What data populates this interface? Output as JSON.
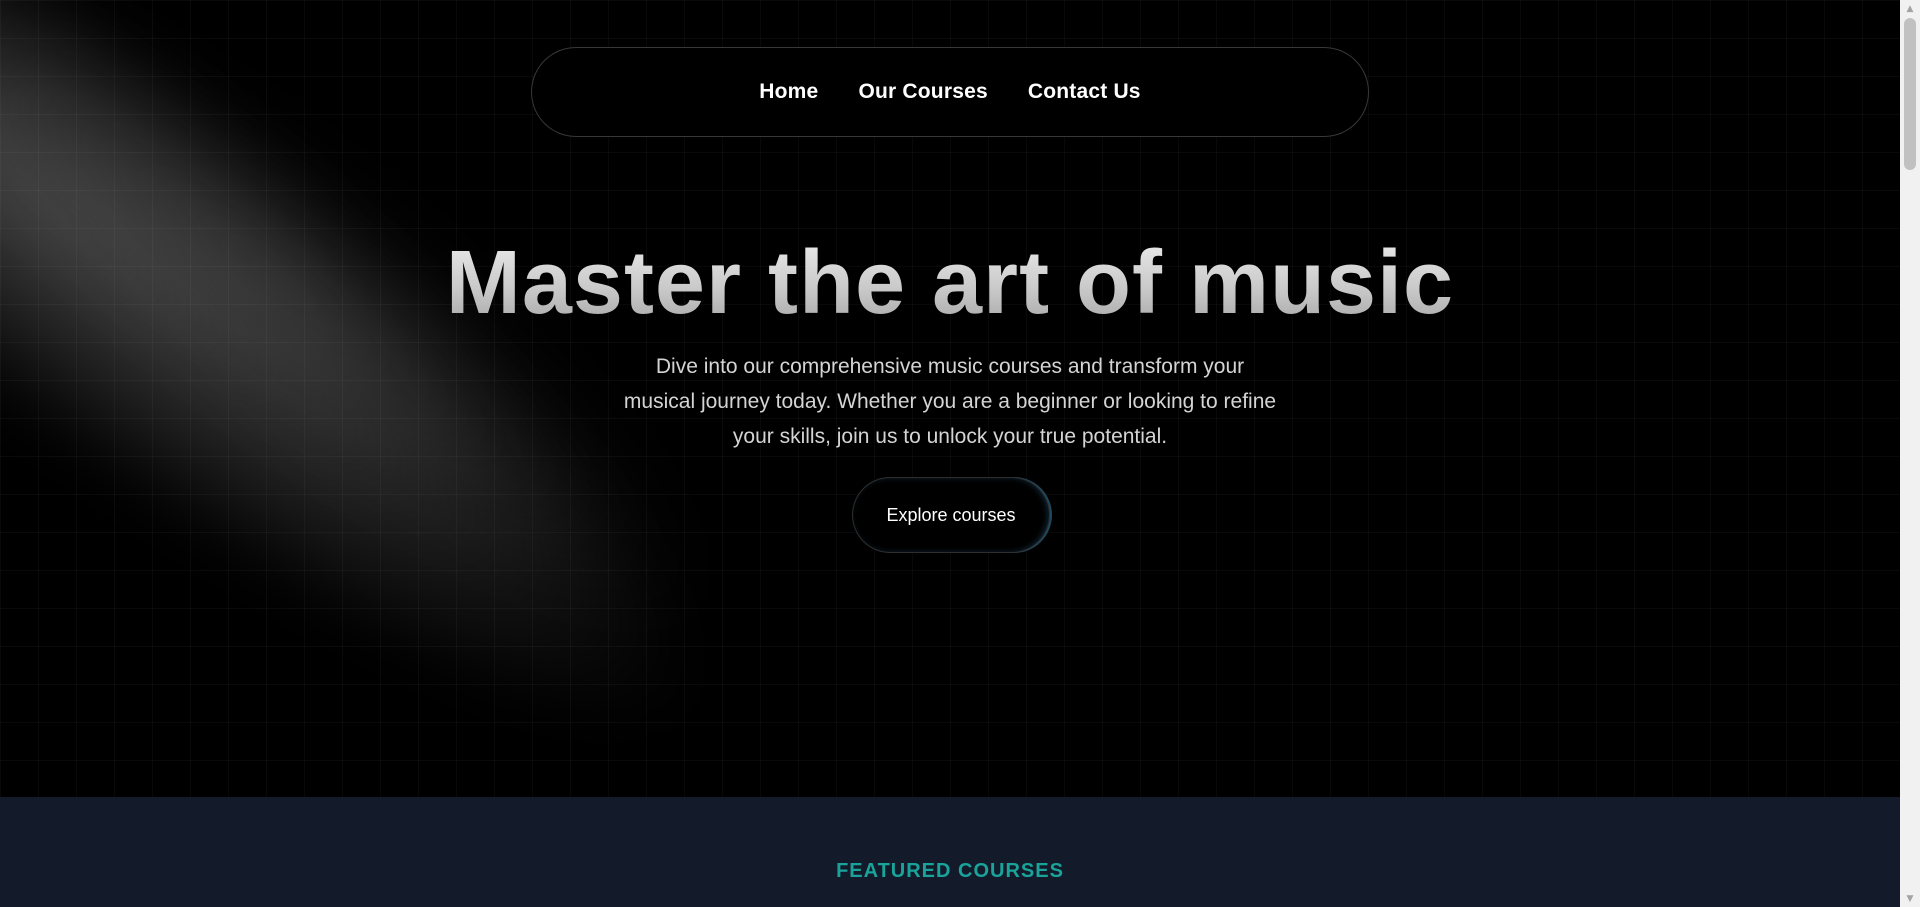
{
  "nav": {
    "items": [
      {
        "label": "Home"
      },
      {
        "label": "Our Courses"
      },
      {
        "label": "Contact Us"
      }
    ]
  },
  "hero": {
    "title": "Master the art of music",
    "subtitle": "Dive into our comprehensive music courses and transform your musical journey today. Whether you are a beginner or looking to refine your skills, join us to unlock your true potential.",
    "cta_label": "Explore courses"
  },
  "featured": {
    "heading": "FEATURED COURSES"
  },
  "scrollbar": {
    "up_icon": "▲",
    "down_icon": "▼"
  },
  "colors": {
    "background": "#000000",
    "featured_background": "#131a29",
    "accent": "#1aa39a"
  }
}
